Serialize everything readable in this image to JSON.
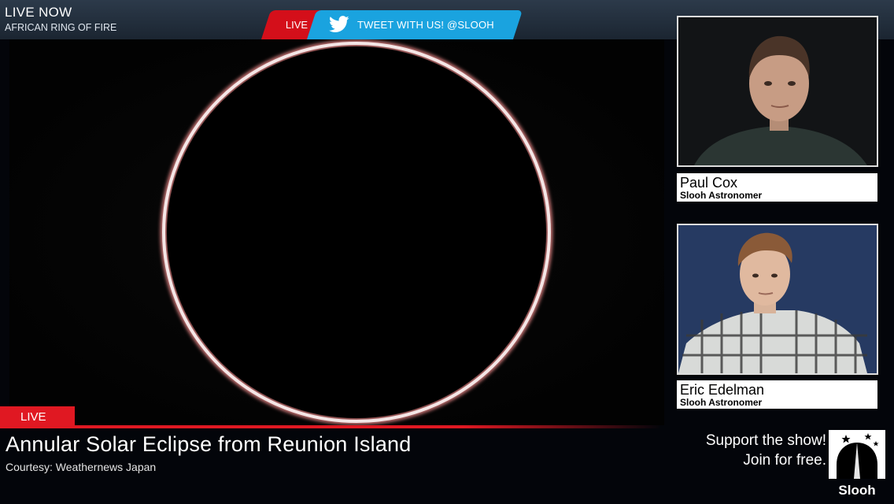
{
  "header": {
    "live_now": "LIVE NOW",
    "event_name": "AFRICAN RING OF FIRE",
    "live_tab": "LIVE",
    "tweet_label": "TWEET WITH US! @SLOOH"
  },
  "lower_third": {
    "live_badge": "LIVE",
    "title": "Annular Solar Eclipse from Reunion Island",
    "credit": "Courtesy: Weathernews Japan"
  },
  "presenters": [
    {
      "name": "Paul Cox",
      "role": "Slooh Astronomer"
    },
    {
      "name": "Eric Edelman",
      "role": "Slooh Astronomer"
    }
  ],
  "support": {
    "line1": "Support the show!",
    "line2": "Join for free.",
    "logo_text": "Slooh"
  },
  "colors": {
    "live_red": "#e01822",
    "twitter_blue": "#1aa3df",
    "topbar": "#1b2531"
  },
  "icons": {
    "twitter": "twitter-bird-icon",
    "logo": "slooh-observatory-logo"
  }
}
